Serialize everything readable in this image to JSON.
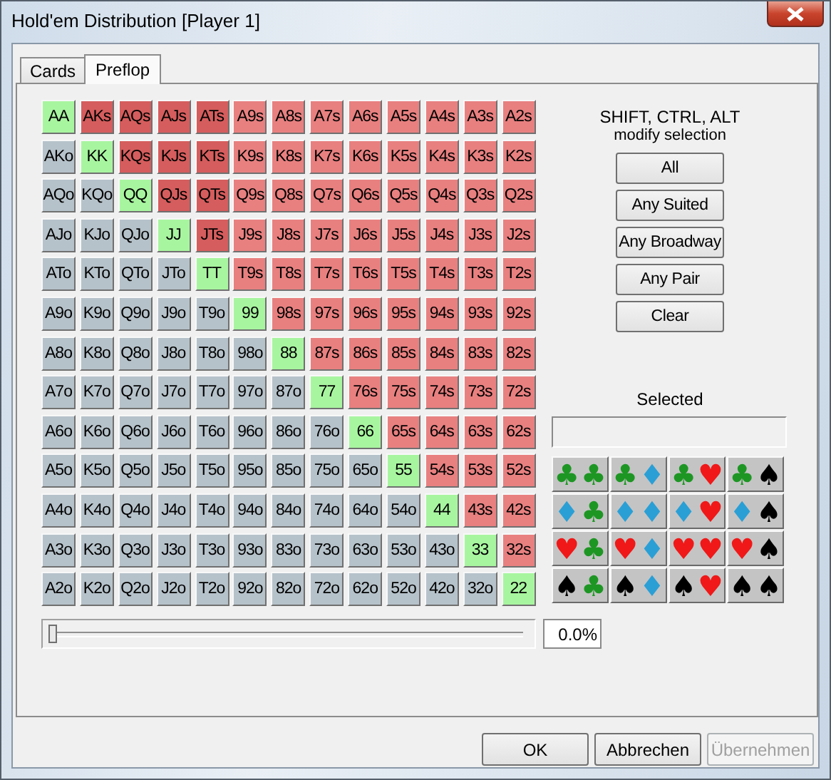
{
  "window": {
    "title": "Hold'em Distribution [Player 1]"
  },
  "tabs": [
    {
      "label": "Cards",
      "selected": false
    },
    {
      "label": "Preflop",
      "selected": true
    }
  ],
  "hand_grid": {
    "rows": [
      [
        {
          "label": "AA",
          "kind": "pair"
        },
        {
          "label": "AKs",
          "kind": "broadway"
        },
        {
          "label": "AQs",
          "kind": "broadway"
        },
        {
          "label": "AJs",
          "kind": "broadway"
        },
        {
          "label": "ATs",
          "kind": "broadway"
        },
        {
          "label": "A9s",
          "kind": "suited"
        },
        {
          "label": "A8s",
          "kind": "suited"
        },
        {
          "label": "A7s",
          "kind": "suited"
        },
        {
          "label": "A6s",
          "kind": "suited"
        },
        {
          "label": "A5s",
          "kind": "suited"
        },
        {
          "label": "A4s",
          "kind": "suited"
        },
        {
          "label": "A3s",
          "kind": "suited"
        },
        {
          "label": "A2s",
          "kind": "suited"
        }
      ],
      [
        {
          "label": "AKo",
          "kind": "offsuit"
        },
        {
          "label": "KK",
          "kind": "pair"
        },
        {
          "label": "KQs",
          "kind": "broadway"
        },
        {
          "label": "KJs",
          "kind": "broadway"
        },
        {
          "label": "KTs",
          "kind": "broadway"
        },
        {
          "label": "K9s",
          "kind": "suited"
        },
        {
          "label": "K8s",
          "kind": "suited"
        },
        {
          "label": "K7s",
          "kind": "suited"
        },
        {
          "label": "K6s",
          "kind": "suited"
        },
        {
          "label": "K5s",
          "kind": "suited"
        },
        {
          "label": "K4s",
          "kind": "suited"
        },
        {
          "label": "K3s",
          "kind": "suited"
        },
        {
          "label": "K2s",
          "kind": "suited"
        }
      ],
      [
        {
          "label": "AQo",
          "kind": "offsuit"
        },
        {
          "label": "KQo",
          "kind": "offsuit"
        },
        {
          "label": "QQ",
          "kind": "pair"
        },
        {
          "label": "QJs",
          "kind": "broadway"
        },
        {
          "label": "QTs",
          "kind": "broadway"
        },
        {
          "label": "Q9s",
          "kind": "suited"
        },
        {
          "label": "Q8s",
          "kind": "suited"
        },
        {
          "label": "Q7s",
          "kind": "suited"
        },
        {
          "label": "Q6s",
          "kind": "suited"
        },
        {
          "label": "Q5s",
          "kind": "suited"
        },
        {
          "label": "Q4s",
          "kind": "suited"
        },
        {
          "label": "Q3s",
          "kind": "suited"
        },
        {
          "label": "Q2s",
          "kind": "suited"
        }
      ],
      [
        {
          "label": "AJo",
          "kind": "offsuit"
        },
        {
          "label": "KJo",
          "kind": "offsuit"
        },
        {
          "label": "QJo",
          "kind": "offsuit"
        },
        {
          "label": "JJ",
          "kind": "pair"
        },
        {
          "label": "JTs",
          "kind": "broadway"
        },
        {
          "label": "J9s",
          "kind": "suited"
        },
        {
          "label": "J8s",
          "kind": "suited"
        },
        {
          "label": "J7s",
          "kind": "suited"
        },
        {
          "label": "J6s",
          "kind": "suited"
        },
        {
          "label": "J5s",
          "kind": "suited"
        },
        {
          "label": "J4s",
          "kind": "suited"
        },
        {
          "label": "J3s",
          "kind": "suited"
        },
        {
          "label": "J2s",
          "kind": "suited"
        }
      ],
      [
        {
          "label": "ATo",
          "kind": "offsuit"
        },
        {
          "label": "KTo",
          "kind": "offsuit"
        },
        {
          "label": "QTo",
          "kind": "offsuit"
        },
        {
          "label": "JTo",
          "kind": "offsuit"
        },
        {
          "label": "TT",
          "kind": "pair"
        },
        {
          "label": "T9s",
          "kind": "suited"
        },
        {
          "label": "T8s",
          "kind": "suited"
        },
        {
          "label": "T7s",
          "kind": "suited"
        },
        {
          "label": "T6s",
          "kind": "suited"
        },
        {
          "label": "T5s",
          "kind": "suited"
        },
        {
          "label": "T4s",
          "kind": "suited"
        },
        {
          "label": "T3s",
          "kind": "suited"
        },
        {
          "label": "T2s",
          "kind": "suited"
        }
      ],
      [
        {
          "label": "A9o",
          "kind": "offsuit"
        },
        {
          "label": "K9o",
          "kind": "offsuit"
        },
        {
          "label": "Q9o",
          "kind": "offsuit"
        },
        {
          "label": "J9o",
          "kind": "offsuit"
        },
        {
          "label": "T9o",
          "kind": "offsuit"
        },
        {
          "label": "99",
          "kind": "pair"
        },
        {
          "label": "98s",
          "kind": "suited"
        },
        {
          "label": "97s",
          "kind": "suited"
        },
        {
          "label": "96s",
          "kind": "suited"
        },
        {
          "label": "95s",
          "kind": "suited"
        },
        {
          "label": "94s",
          "kind": "suited"
        },
        {
          "label": "93s",
          "kind": "suited"
        },
        {
          "label": "92s",
          "kind": "suited"
        }
      ],
      [
        {
          "label": "A8o",
          "kind": "offsuit"
        },
        {
          "label": "K8o",
          "kind": "offsuit"
        },
        {
          "label": "Q8o",
          "kind": "offsuit"
        },
        {
          "label": "J8o",
          "kind": "offsuit"
        },
        {
          "label": "T8o",
          "kind": "offsuit"
        },
        {
          "label": "98o",
          "kind": "offsuit"
        },
        {
          "label": "88",
          "kind": "pair"
        },
        {
          "label": "87s",
          "kind": "suited"
        },
        {
          "label": "86s",
          "kind": "suited"
        },
        {
          "label": "85s",
          "kind": "suited"
        },
        {
          "label": "84s",
          "kind": "suited"
        },
        {
          "label": "83s",
          "kind": "suited"
        },
        {
          "label": "82s",
          "kind": "suited"
        }
      ],
      [
        {
          "label": "A7o",
          "kind": "offsuit"
        },
        {
          "label": "K7o",
          "kind": "offsuit"
        },
        {
          "label": "Q7o",
          "kind": "offsuit"
        },
        {
          "label": "J7o",
          "kind": "offsuit"
        },
        {
          "label": "T7o",
          "kind": "offsuit"
        },
        {
          "label": "97o",
          "kind": "offsuit"
        },
        {
          "label": "87o",
          "kind": "offsuit"
        },
        {
          "label": "77",
          "kind": "pair"
        },
        {
          "label": "76s",
          "kind": "suited"
        },
        {
          "label": "75s",
          "kind": "suited"
        },
        {
          "label": "74s",
          "kind": "suited"
        },
        {
          "label": "73s",
          "kind": "suited"
        },
        {
          "label": "72s",
          "kind": "suited"
        }
      ],
      [
        {
          "label": "A6o",
          "kind": "offsuit"
        },
        {
          "label": "K6o",
          "kind": "offsuit"
        },
        {
          "label": "Q6o",
          "kind": "offsuit"
        },
        {
          "label": "J6o",
          "kind": "offsuit"
        },
        {
          "label": "T6o",
          "kind": "offsuit"
        },
        {
          "label": "96o",
          "kind": "offsuit"
        },
        {
          "label": "86o",
          "kind": "offsuit"
        },
        {
          "label": "76o",
          "kind": "offsuit"
        },
        {
          "label": "66",
          "kind": "pair"
        },
        {
          "label": "65s",
          "kind": "suited"
        },
        {
          "label": "64s",
          "kind": "suited"
        },
        {
          "label": "63s",
          "kind": "suited"
        },
        {
          "label": "62s",
          "kind": "suited"
        }
      ],
      [
        {
          "label": "A5o",
          "kind": "offsuit"
        },
        {
          "label": "K5o",
          "kind": "offsuit"
        },
        {
          "label": "Q5o",
          "kind": "offsuit"
        },
        {
          "label": "J5o",
          "kind": "offsuit"
        },
        {
          "label": "T5o",
          "kind": "offsuit"
        },
        {
          "label": "95o",
          "kind": "offsuit"
        },
        {
          "label": "85o",
          "kind": "offsuit"
        },
        {
          "label": "75o",
          "kind": "offsuit"
        },
        {
          "label": "65o",
          "kind": "offsuit"
        },
        {
          "label": "55",
          "kind": "pair"
        },
        {
          "label": "54s",
          "kind": "suited"
        },
        {
          "label": "53s",
          "kind": "suited"
        },
        {
          "label": "52s",
          "kind": "suited"
        }
      ],
      [
        {
          "label": "A4o",
          "kind": "offsuit"
        },
        {
          "label": "K4o",
          "kind": "offsuit"
        },
        {
          "label": "Q4o",
          "kind": "offsuit"
        },
        {
          "label": "J4o",
          "kind": "offsuit"
        },
        {
          "label": "T4o",
          "kind": "offsuit"
        },
        {
          "label": "94o",
          "kind": "offsuit"
        },
        {
          "label": "84o",
          "kind": "offsuit"
        },
        {
          "label": "74o",
          "kind": "offsuit"
        },
        {
          "label": "64o",
          "kind": "offsuit"
        },
        {
          "label": "54o",
          "kind": "offsuit"
        },
        {
          "label": "44",
          "kind": "pair"
        },
        {
          "label": "43s",
          "kind": "suited"
        },
        {
          "label": "42s",
          "kind": "suited"
        }
      ],
      [
        {
          "label": "A3o",
          "kind": "offsuit"
        },
        {
          "label": "K3o",
          "kind": "offsuit"
        },
        {
          "label": "Q3o",
          "kind": "offsuit"
        },
        {
          "label": "J3o",
          "kind": "offsuit"
        },
        {
          "label": "T3o",
          "kind": "offsuit"
        },
        {
          "label": "93o",
          "kind": "offsuit"
        },
        {
          "label": "83o",
          "kind": "offsuit"
        },
        {
          "label": "73o",
          "kind": "offsuit"
        },
        {
          "label": "63o",
          "kind": "offsuit"
        },
        {
          "label": "53o",
          "kind": "offsuit"
        },
        {
          "label": "43o",
          "kind": "offsuit"
        },
        {
          "label": "33",
          "kind": "pair"
        },
        {
          "label": "32s",
          "kind": "suited"
        }
      ],
      [
        {
          "label": "A2o",
          "kind": "offsuit"
        },
        {
          "label": "K2o",
          "kind": "offsuit"
        },
        {
          "label": "Q2o",
          "kind": "offsuit"
        },
        {
          "label": "J2o",
          "kind": "offsuit"
        },
        {
          "label": "T2o",
          "kind": "offsuit"
        },
        {
          "label": "92o",
          "kind": "offsuit"
        },
        {
          "label": "82o",
          "kind": "offsuit"
        },
        {
          "label": "72o",
          "kind": "offsuit"
        },
        {
          "label": "62o",
          "kind": "offsuit"
        },
        {
          "label": "52o",
          "kind": "offsuit"
        },
        {
          "label": "42o",
          "kind": "offsuit"
        },
        {
          "label": "32o",
          "kind": "offsuit"
        },
        {
          "label": "22",
          "kind": "pair"
        }
      ]
    ]
  },
  "range_slider": {
    "level": 0,
    "reading": "0.0%"
  },
  "side_panel": {
    "hint": [
      "SHIFT, CTRL, ALT",
      "modify selection"
    ],
    "buttons": [
      "All",
      "Any Suited",
      "Any Broadway",
      "Any Pair",
      "Clear"
    ],
    "selected_label": "Selected",
    "suit_buttons": [
      [
        {
          "symbol": "♣",
          "color": "#1e9624"
        },
        {
          "symbol": "♣",
          "color": "#1e9624"
        }
      ],
      [
        {
          "symbol": "♣",
          "color": "#1e9624"
        },
        {
          "symbol": "♦",
          "color": "#2a9fd6"
        }
      ],
      [
        {
          "symbol": "♣",
          "color": "#1e9624"
        },
        {
          "symbol": "♥",
          "color": "#f01818"
        }
      ],
      [
        {
          "symbol": "♣",
          "color": "#1e9624"
        },
        {
          "symbol": "♠",
          "color": "#000000"
        }
      ],
      [
        {
          "symbol": "♦",
          "color": "#2a9fd6"
        },
        {
          "symbol": "♣",
          "color": "#1e9624"
        }
      ],
      [
        {
          "symbol": "♦",
          "color": "#2a9fd6"
        },
        {
          "symbol": "♦",
          "color": "#2a9fd6"
        }
      ],
      [
        {
          "symbol": "♦",
          "color": "#2a9fd6"
        },
        {
          "symbol": "♥",
          "color": "#f01818"
        }
      ],
      [
        {
          "symbol": "♦",
          "color": "#2a9fd6"
        },
        {
          "symbol": "♠",
          "color": "#000000"
        }
      ],
      [
        {
          "symbol": "♥",
          "color": "#f01818"
        },
        {
          "symbol": "♣",
          "color": "#1e9624"
        }
      ],
      [
        {
          "symbol": "♥",
          "color": "#f01818"
        },
        {
          "symbol": "♦",
          "color": "#2a9fd6"
        }
      ],
      [
        {
          "symbol": "♥",
          "color": "#f01818"
        },
        {
          "symbol": "♥",
          "color": "#f01818"
        }
      ],
      [
        {
          "symbol": "♥",
          "color": "#f01818"
        },
        {
          "symbol": "♠",
          "color": "#000000"
        }
      ],
      [
        {
          "symbol": "♠",
          "color": "#000000"
        },
        {
          "symbol": "♣",
          "color": "#1e9624"
        }
      ],
      [
        {
          "symbol": "♠",
          "color": "#000000"
        },
        {
          "symbol": "♦",
          "color": "#2a9fd6"
        }
      ],
      [
        {
          "symbol": "♠",
          "color": "#000000"
        },
        {
          "symbol": "♥",
          "color": "#f01818"
        }
      ],
      [
        {
          "symbol": "♠",
          "color": "#000000"
        },
        {
          "symbol": "♠",
          "color": "#000000"
        }
      ]
    ]
  },
  "footer_buttons": [
    {
      "label": "OK",
      "disabled": false
    },
    {
      "label": "Abbrechen",
      "disabled": false
    },
    {
      "label": "Übernehmen",
      "disabled": true
    }
  ]
}
